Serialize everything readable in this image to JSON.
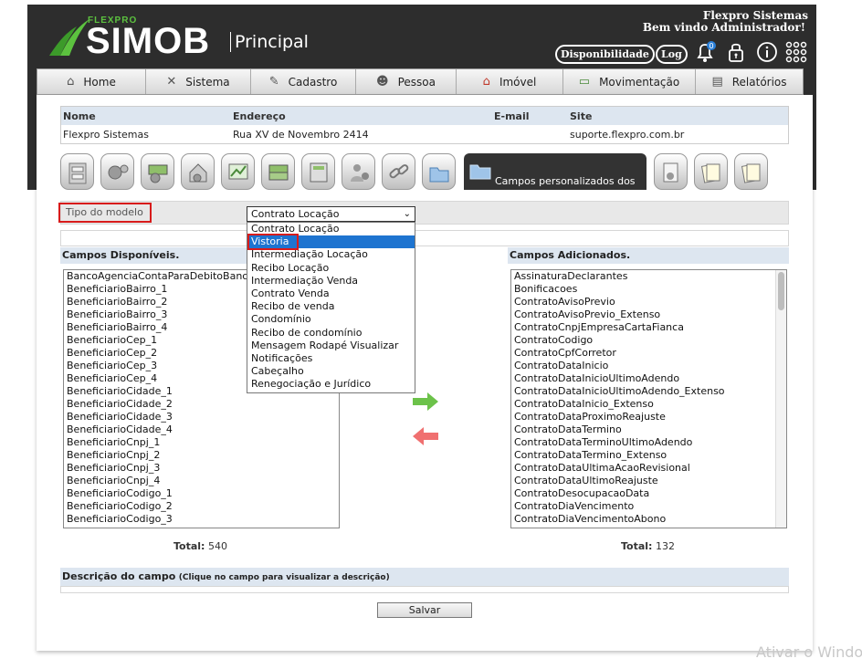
{
  "header": {
    "brand_small": "FLEXPRO",
    "brand": "SIMOB",
    "section": "Principal",
    "company": "Flexpro Sistemas",
    "welcome": "Bem vindo Administrador!",
    "availability_button": "Disponibilidade",
    "log_button": "Log",
    "notification_count": "0"
  },
  "nav": [
    "Home",
    "Sistema",
    "Cadastro",
    "Pessoa",
    "Imóvel",
    "Movimentação",
    "Relatórios"
  ],
  "company_info": {
    "headers": [
      "Nome",
      "Endereço",
      "E-mail",
      "Site"
    ],
    "values": [
      "Flexpro Sistemas",
      "Rua XV de Novembro 2414",
      "",
      "suporte.flexpro.com.br"
    ]
  },
  "active_tab_label": "Campos personalizados dos",
  "form": {
    "model_type_label": "Tipo do modelo",
    "model_type_value": "Contrato Locação",
    "model_type_options": [
      "Contrato Locação",
      "Vistoria",
      "Intermediação Locação",
      "Recibo Locação",
      "Intermediação Venda",
      "Contrato Venda",
      "Recibo de venda",
      "Condomínio",
      "Recibo de condomínio",
      "Mensagem Rodapé Visualizar",
      "Notificações",
      "Cabeçalho",
      "Renegociação e Jurídico"
    ],
    "highlighted_option": "Vistoria"
  },
  "available": {
    "title": "Campos Disponíveis.",
    "items": [
      "BancoAgenciaContaParaDebitoBanca",
      "BeneficiarioBairro_1",
      "BeneficiarioBairro_2",
      "BeneficiarioBairro_3",
      "BeneficiarioBairro_4",
      "BeneficiarioCep_1",
      "BeneficiarioCep_2",
      "BeneficiarioCep_3",
      "BeneficiarioCep_4",
      "BeneficiarioCidade_1",
      "BeneficiarioCidade_2",
      "BeneficiarioCidade_3",
      "BeneficiarioCidade_4",
      "BeneficiarioCnpj_1",
      "BeneficiarioCnpj_2",
      "BeneficiarioCnpj_3",
      "BeneficiarioCnpj_4",
      "BeneficiarioCodigo_1",
      "BeneficiarioCodigo_2",
      "BeneficiarioCodigo_3"
    ],
    "total_label": "Total:",
    "total": "540"
  },
  "added": {
    "title": "Campos Adicionados.",
    "items": [
      "AssinaturaDeclarantes",
      "Bonificacoes",
      "ContratoAvisoPrevio",
      "ContratoAvisoPrevio_Extenso",
      "ContratoCnpjEmpresaCartaFianca",
      "ContratoCodigo",
      "ContratoCpfCorretor",
      "ContratoDataInicio",
      "ContratoDataInicioUltimoAdendo",
      "ContratoDataInicioUltimoAdendo_Extenso",
      "ContratoDataInicio_Extenso",
      "ContratoDataProximoReajuste",
      "ContratoDataTermino",
      "ContratoDataTerminoUltimoAdendo",
      "ContratoDataTermino_Extenso",
      "ContratoDataUltimaAcaoRevisional",
      "ContratoDataUltimoReajuste",
      "ContratoDesocupacaoData",
      "ContratoDiaVencimento",
      "ContratoDiaVencimentoAbono"
    ],
    "total_label": "Total:",
    "total": "132"
  },
  "description": {
    "label": "Descrição do campo",
    "hint": "(Clique no campo para visualizar a descrição)"
  },
  "save_button": "Salvar",
  "watermark": "Ativar o Windows",
  "colors": {
    "header_bg": "#2d2d2d",
    "brand_green": "#5cc23f",
    "highlight_red": "#d81b1b",
    "select_blue": "#1e74d0"
  }
}
